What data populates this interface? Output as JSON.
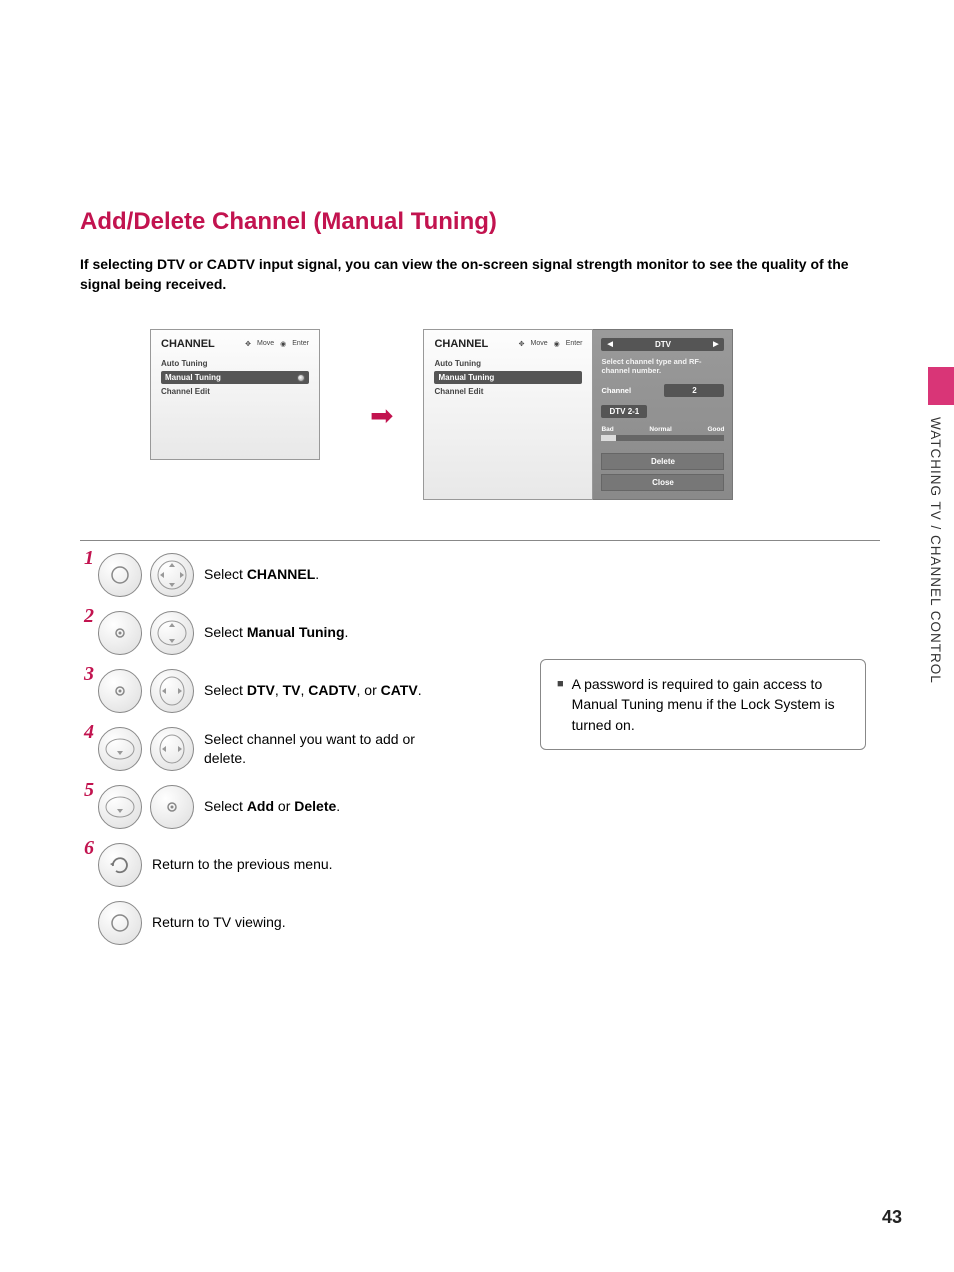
{
  "heading": "Add/Delete Channel (Manual Tuning)",
  "intro": "If selecting DTV or CADTV input signal, you can view the on-screen signal strength monitor to see the quality of the signal being received.",
  "menu": {
    "title": "CHANNEL",
    "hint_move": "Move",
    "hint_enter": "Enter",
    "items": [
      "Auto Tuning",
      "Manual Tuning",
      "Channel Edit"
    ]
  },
  "panel": {
    "signal_type": "DTV",
    "help": "Select channel type and RF-channel number.",
    "channel_label": "Channel",
    "channel_value": "2",
    "found": "DTV 2-1",
    "meter": {
      "bad": "Bad",
      "normal": "Normal",
      "good": "Good"
    },
    "btn_delete": "Delete",
    "btn_close": "Close"
  },
  "steps": {
    "s1": {
      "pre": "Select ",
      "b": "CHANNEL",
      "post": "."
    },
    "s2": {
      "pre": "Select ",
      "b": "Manual Tuning",
      "post": "."
    },
    "s3": {
      "pre": "Select ",
      "b": "DTV",
      "mid1": ", ",
      "b2": "TV",
      "mid2": ", ",
      "b3": "CADTV",
      "mid3": ", or ",
      "b4": "CATV",
      "post": "."
    },
    "s4": "Select channel you want to add or delete.",
    "s5": {
      "pre": "Select ",
      "b": "Add",
      "mid": " or ",
      "b2": "Delete",
      "post": "."
    },
    "s6": "Return to the previous menu.",
    "s7": "Return to TV viewing."
  },
  "note": "A password is required to gain access to Manual Tuning menu if the Lock System is turned on.",
  "side_label": "WATCHING TV / CHANNEL CONTROL",
  "page_number": "43"
}
